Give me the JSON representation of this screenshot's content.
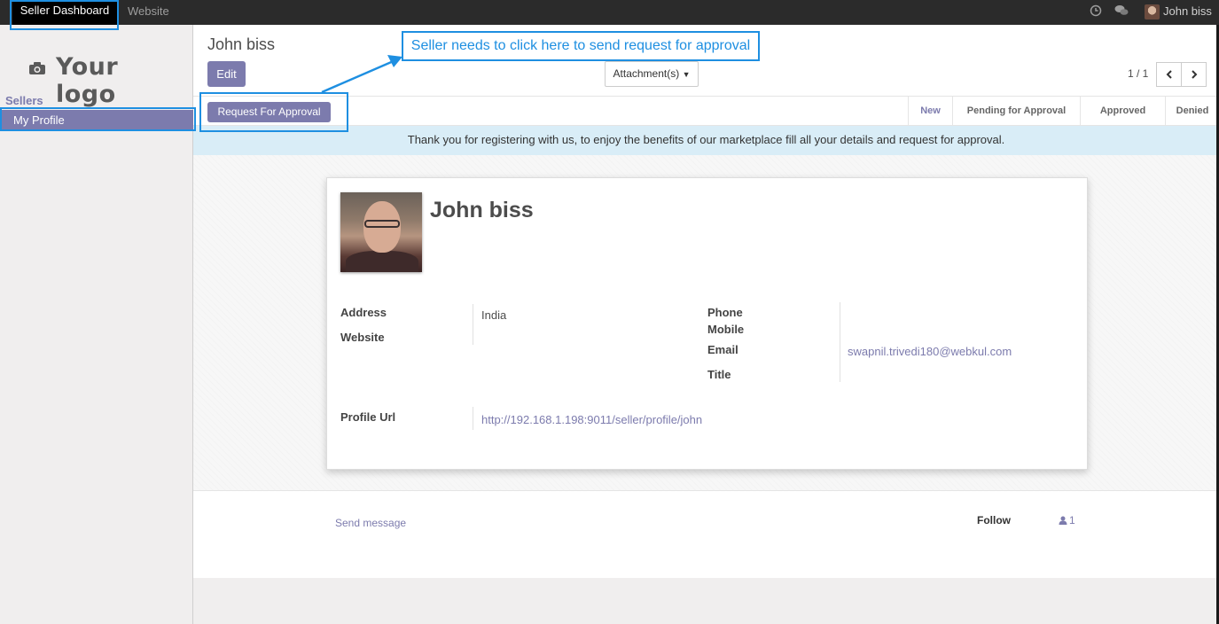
{
  "topbar": {
    "menus": [
      "Seller Dashboard",
      "Website"
    ],
    "user_name": "John biss",
    "icons": [
      "clock-icon",
      "chat-icon"
    ]
  },
  "sidebar": {
    "logo_text": "Your logo",
    "section": "Sellers",
    "items": [
      {
        "label": "My Profile",
        "active": true
      }
    ]
  },
  "control_panel": {
    "title": "John biss",
    "edit_label": "Edit",
    "attachments_label": "Attachment(s)",
    "pager": "1 / 1"
  },
  "statusbar": {
    "request_label": "Request For Approval",
    "stages": [
      {
        "label": "New",
        "active": true
      },
      {
        "label": "Pending for Approval",
        "active": false
      },
      {
        "label": "Approved",
        "active": false
      },
      {
        "label": "Denied",
        "active": false
      }
    ]
  },
  "banner": "Thank you for registering with us, to enjoy the benefits of our marketplace fill all your details and request for approval.",
  "form": {
    "name": "John biss",
    "labels": {
      "address": "Address",
      "website": "Website",
      "phone": "Phone",
      "mobile": "Mobile",
      "email": "Email",
      "title": "Title",
      "profile_url": "Profile Url"
    },
    "values": {
      "address": "India",
      "email": "swapnil.trivedi180@webkul.com",
      "profile_url": "http://192.168.1.198:9011/seller/profile/john"
    }
  },
  "chatter": {
    "send_message": "Send message",
    "follow": "Follow",
    "followers_count": "1"
  },
  "annotation": {
    "callout_text": "Seller needs to click here to send request for approval",
    "color": "#1e8fe1"
  },
  "colors": {
    "accent": "#7c7bad",
    "topbar": "#2b2b2b",
    "banner": "#d9edf7"
  }
}
